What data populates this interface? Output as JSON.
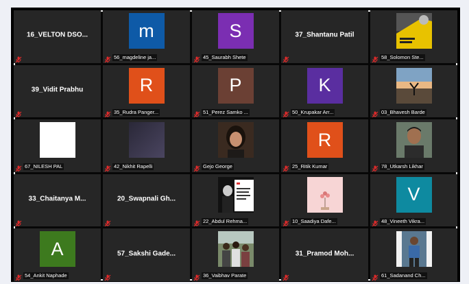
{
  "meeting": {
    "tiles": [
      {
        "label": "16_VELTON  DSO...",
        "kind": "text"
      },
      {
        "label": "56_magdeline ja...",
        "kind": "letter",
        "letter": "m",
        "color": "#0e5aa7"
      },
      {
        "label": "45_Saurabh Shete",
        "kind": "letter",
        "letter": "S",
        "color": "#7b2eb2"
      },
      {
        "label": "37_Shantanu Patil",
        "kind": "text"
      },
      {
        "label": "58_Solomon Ste...",
        "kind": "photo",
        "photo": "book-cover-photo"
      },
      {
        "label": "39_Vidit Prabhu",
        "kind": "text"
      },
      {
        "label": "35_Rudra Panger...",
        "kind": "letter",
        "letter": "R",
        "color": "#e0501a"
      },
      {
        "label": "51_Perez Samko ...",
        "kind": "letter",
        "letter": "P",
        "color": "#6b4034"
      },
      {
        "label": "50_Krupakar Arr...",
        "kind": "letter",
        "letter": "K",
        "color": "#5a2ea0"
      },
      {
        "label": "03_Bhavesh Barde",
        "kind": "photo",
        "photo": "sunset-pose-photo"
      },
      {
        "label": "67_NILESH PAL",
        "kind": "photo",
        "photo": "white-blank-photo"
      },
      {
        "label": "42_Nikhit Rapelli",
        "kind": "photo",
        "photo": "dark-blur-photo"
      },
      {
        "label": "Gejo George",
        "kind": "photo",
        "photo": "woman-portrait-photo"
      },
      {
        "label": "25_Ritik Kumar",
        "kind": "letter",
        "letter": "R",
        "color": "#e0501a"
      },
      {
        "label": "78_Utkarsh Likhar",
        "kind": "photo",
        "photo": "man-portrait-photo"
      },
      {
        "label": "33_Chaitanya  M...",
        "kind": "text"
      },
      {
        "label": "20_Swapnali  Gh...",
        "kind": "text"
      },
      {
        "label": "22_Abdul Rehma...",
        "kind": "photo",
        "photo": "quote-card-photo"
      },
      {
        "label": "10_Saadiya Dafe...",
        "kind": "photo",
        "photo": "pink-flower-photo"
      },
      {
        "label": "48_Vineeth Vikra...",
        "kind": "letter",
        "letter": "V",
        "color": "#0e8aa0"
      },
      {
        "label": "54_Ankit Naphade",
        "kind": "letter",
        "letter": "A",
        "color": "#3d7a1e"
      },
      {
        "label": "57_Sakshi  Gade...",
        "kind": "text"
      },
      {
        "label": "36_Vaibhav Parate",
        "kind": "photo",
        "photo": "group-outdoor-photo"
      },
      {
        "label": "31_Pramod  Moh...",
        "kind": "text"
      },
      {
        "label": "61_Sadanand Ch...",
        "kind": "photo",
        "photo": "man-standing-photo"
      }
    ]
  }
}
